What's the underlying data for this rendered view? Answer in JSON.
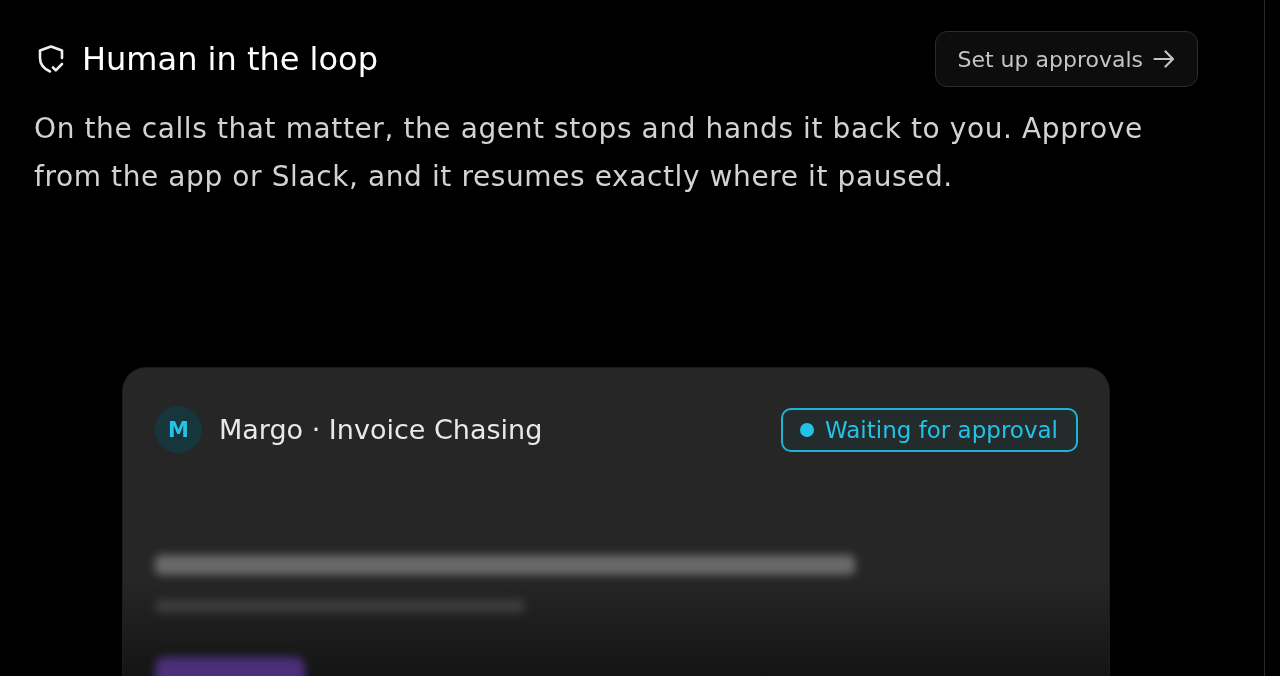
{
  "section": {
    "title": "Human in the loop",
    "action": {
      "label": "Set up approvals"
    },
    "description": "On the calls that matter, the agent stops and hands it back to you. Approve from the app or Slack, and it resumes exactly where it paused."
  },
  "approval_card": {
    "avatar": {
      "initial": "M"
    },
    "title": "Margo · Invoice Chasing",
    "status": {
      "label": "Waiting for approval"
    }
  }
}
